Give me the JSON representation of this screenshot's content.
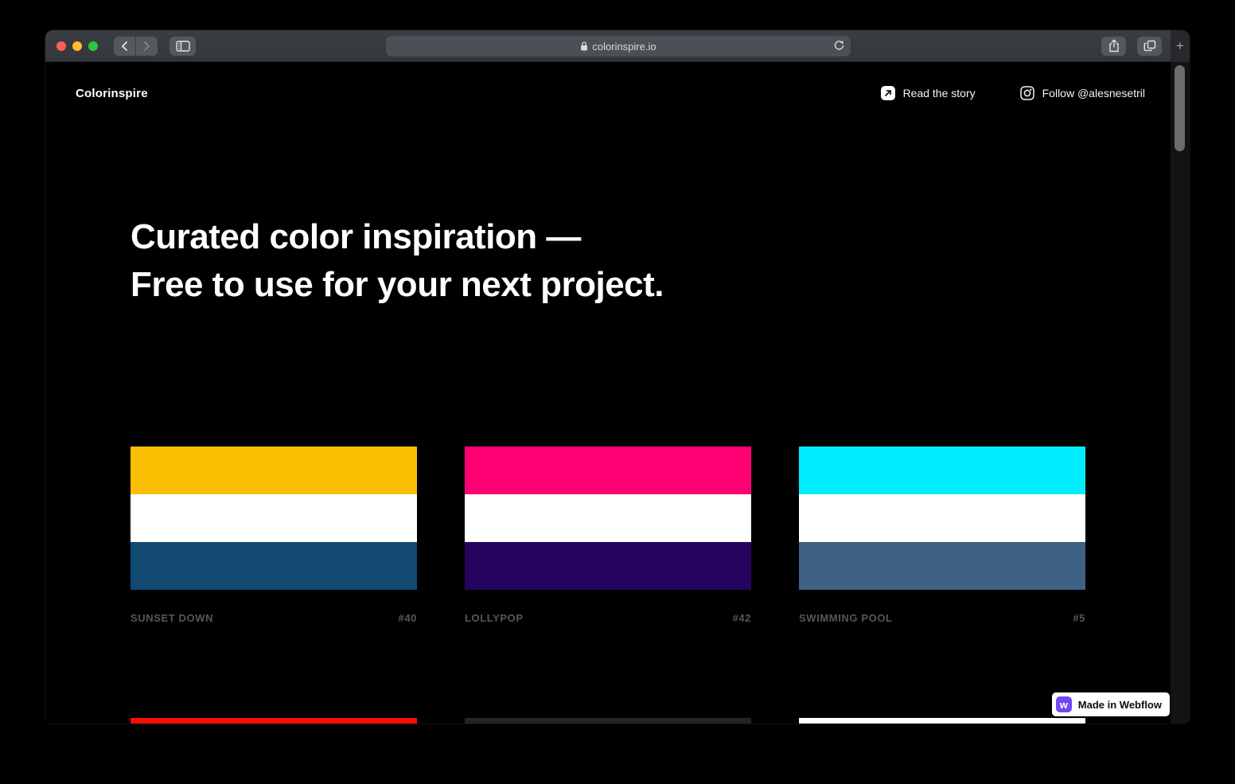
{
  "browser": {
    "url": "colorinspire.io",
    "new_tab_label": "+",
    "traffic_lights": {
      "close": "#FF5F57",
      "minimize": "#FEBC2E",
      "zoom": "#28C840"
    }
  },
  "header": {
    "logo": "Colorinspire",
    "read_story_label": "Read the story",
    "follow_label": "Follow @alesnesetril"
  },
  "hero": {
    "line1": "Curated color inspiration —",
    "line2": "Free to use for your next project."
  },
  "palettes": [
    {
      "name": "SUNSET DOWN",
      "number": "#40",
      "colors": [
        "#FCBE02",
        "#FFFFFF",
        "#124A73"
      ]
    },
    {
      "name": "LOLLYPOP",
      "number": "#42",
      "colors": [
        "#FF0072",
        "#FFFFFF",
        "#26045E"
      ]
    },
    {
      "name": "SWIMMING POOL",
      "number": "#5",
      "colors": [
        "#00EEFF",
        "#FFFFFF",
        "#3D6284"
      ]
    }
  ],
  "next_row_palettes": [
    {
      "top_color": "#FB0D00"
    },
    {
      "top_color": "#22242A"
    },
    {
      "top_color": "#FFFFFF"
    }
  ],
  "badge": {
    "label": "Made in Webflow",
    "icon_letter": "w",
    "icon_color": "#6E4BF1"
  }
}
